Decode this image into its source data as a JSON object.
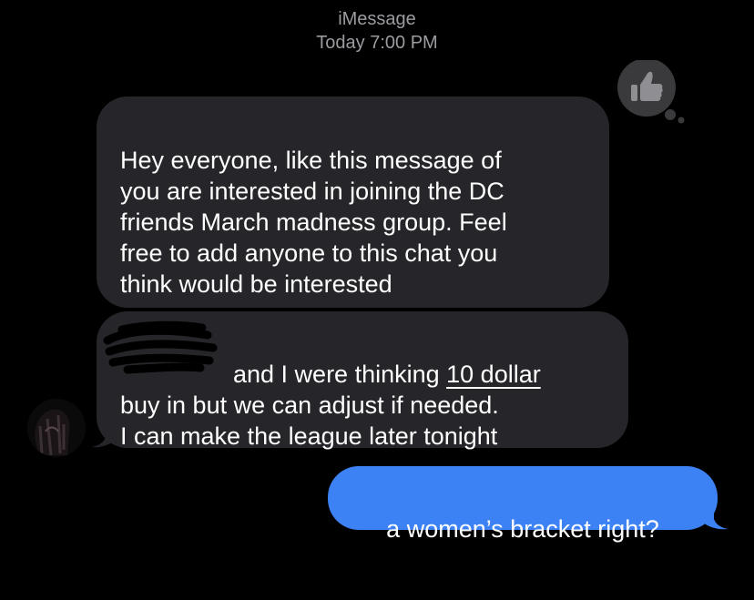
{
  "header": {
    "service": "iMessage",
    "timestamp": "Today 7:00 PM"
  },
  "messages": [
    {
      "direction": "incoming",
      "text": "Hey everyone, like this message of\nyou are interested in joining the DC\nfriends March madness group. Feel\nfree to add anyone to this chat you\nthink would be interested",
      "tapback": "thumbs-up-icon"
    },
    {
      "direction": "incoming",
      "text_before": "and I were thinking ",
      "text_link": "10 dollar",
      "text_after": "\nbuy in but we can adjust if needed.\nI can make the league later tonight"
    },
    {
      "direction": "outgoing",
      "text": "a women’s bracket right?"
    }
  ],
  "colors": {
    "background": "#000000",
    "incoming_bubble": "#26252a",
    "outgoing_bubble": "#3d82f5",
    "meta_text": "#9b9ba0",
    "tapback_bubble": "#3a3a3c"
  }
}
